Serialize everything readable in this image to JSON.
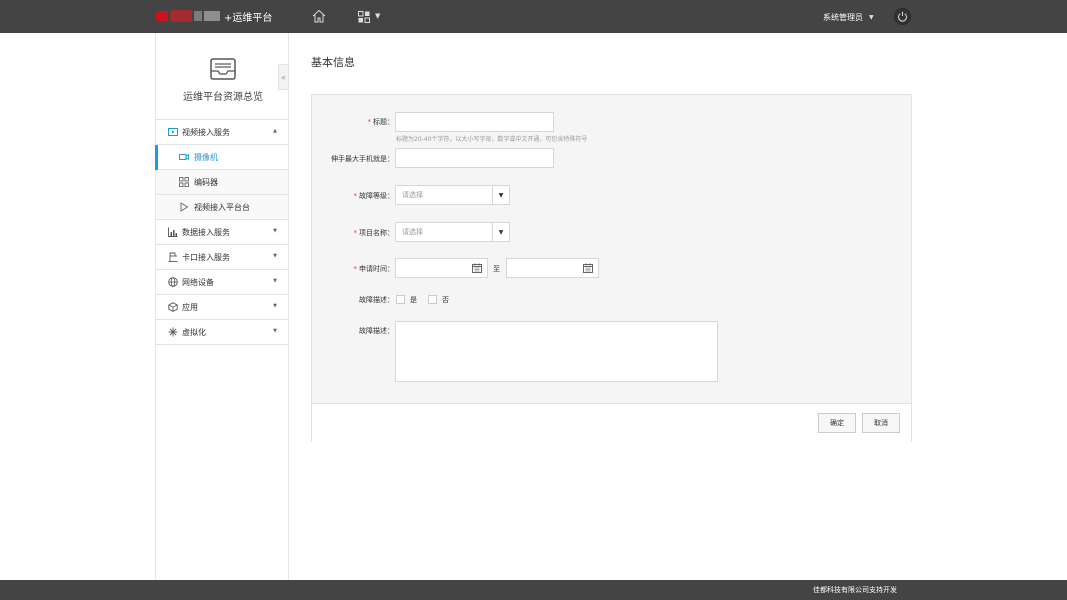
{
  "header": {
    "app_title": "+运维平台",
    "user_name": "系统管理员"
  },
  "sidebar": {
    "title": "运维平台资源总览",
    "collapse_glyph": "«",
    "items": [
      {
        "label": "视频接入服务",
        "icon": "video-service-icon",
        "expanded": true
      },
      {
        "label": "摄像机",
        "icon": "camera-icon",
        "active": true
      },
      {
        "label": "编码器",
        "icon": "encoder-icon"
      },
      {
        "label": "视频接入平台台",
        "icon": "play-icon"
      },
      {
        "label": "数据接入服务",
        "icon": "chart-icon"
      },
      {
        "label": "卡口接入服务",
        "icon": "checkpoint-icon"
      },
      {
        "label": "网络设备",
        "icon": "globe-icon"
      },
      {
        "label": "应用",
        "icon": "cube-icon"
      },
      {
        "label": "虚拟化",
        "icon": "snowflake-icon"
      }
    ]
  },
  "main": {
    "page_title": "基本信息",
    "form": {
      "title_label": "标题：",
      "title_hint": "标题为20-40个字符，以大小写字母，数字或中文开通，可包含特殊符号",
      "phone_label": "伸手最大手机就是：",
      "level_label": "故障等级：",
      "level_placeholder": "请选择",
      "project_label": "项目名称：",
      "project_placeholder": "请选择",
      "time_label": "申请时间：",
      "time_to": "至",
      "desc_check_label": "故障描述：",
      "option_yes": "是",
      "option_no": "否",
      "desc_label": "故障描述：",
      "required_mark": "*"
    },
    "buttons": {
      "confirm": "确定",
      "cancel": "取消"
    }
  },
  "footer": {
    "text": "佳都科技有限公司支持开发"
  },
  "colors": {
    "topbar": "#444444",
    "accent": "#1e9be0",
    "required": "#e4393c"
  }
}
